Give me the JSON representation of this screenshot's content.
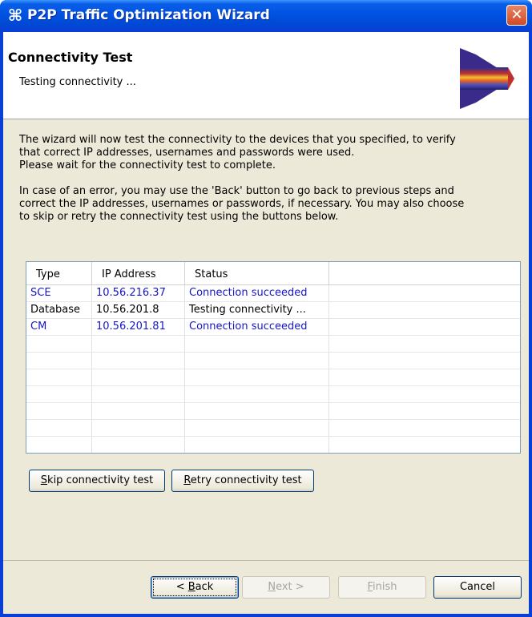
{
  "window": {
    "title": "P2P Traffic Optimization Wizard",
    "icon": "wizard-app-icon",
    "close_label": "✕"
  },
  "header": {
    "title": "Connectivity Test",
    "subtitle": "Testing connectivity ..."
  },
  "description": {
    "para1_line1": "The wizard will now test the connectivity to the devices that you specified, to verify",
    "para1_line2": "that correct IP addresses, usernames and passwords were used.",
    "para1_line3": "Please wait for the connectivity test to complete.",
    "para2_line1": "In case of an error, you may use the 'Back' button to go back to previous steps and",
    "para2_line2": "correct the IP addresses, usernames or passwords, if necessary. You may also choose",
    "para2_line3": "to skip or retry the connectivity test using the buttons below."
  },
  "table": {
    "columns": [
      "Type",
      "IP Address",
      "Status"
    ],
    "rows": [
      {
        "type": "SCE",
        "ip": "10.56.216.37",
        "status": "Connection succeeded",
        "color": "#1616c8"
      },
      {
        "type": "Database",
        "ip": "10.56.201.8",
        "status": "Testing connectivity ...",
        "color": "#000000"
      },
      {
        "type": "CM",
        "ip": "10.56.201.81",
        "status": "Connection succeeded",
        "color": "#1616c8"
      }
    ],
    "empty_rows": 9
  },
  "actions": {
    "skip_mnemonic": "S",
    "skip_rest": "kip connectivity test",
    "retry_mnemonic": "R",
    "retry_rest": "etry connectivity test"
  },
  "footer": {
    "back_prefix": "< ",
    "back_mnemonic": "B",
    "back_rest": "ack",
    "next_mnemonic": "N",
    "next_rest": "ext >",
    "finish_mnemonic": "F",
    "finish_rest": "inish",
    "cancel_label": "Cancel"
  },
  "colors": {
    "title_bar": "#0054e3",
    "dialog_bg": "#ece9d8",
    "success_text": "#1616c8"
  }
}
